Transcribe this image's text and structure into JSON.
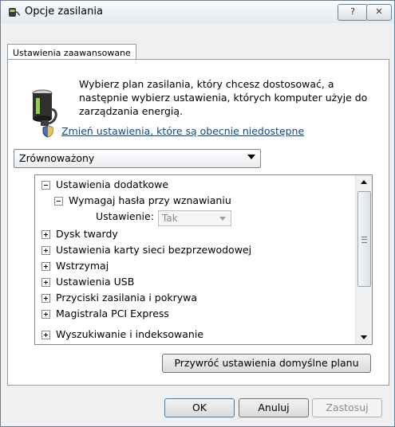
{
  "window": {
    "title": "Opcje zasilania",
    "help_label": "?",
    "close_label": "✕"
  },
  "tab": {
    "label": "Ustawienia zaawansowane"
  },
  "intro": {
    "text": "Wybierz plan zasilania, który chcesz dostosować, a następnie wybierz ustawienia, których komputer użyje do zarządzania energią.",
    "change_link": "Zmień ustawienia, które są obecnie niedostępne"
  },
  "plan_select": {
    "selected": "Zrównoważony"
  },
  "tree": {
    "items": [
      {
        "label": "Ustawienia dodatkowe",
        "expanded": true,
        "level": 0
      },
      {
        "label": "Wymagaj hasła przy wznawianiu",
        "expanded": true,
        "level": 1
      },
      {
        "label": "Ustawienie:",
        "value": "Tak",
        "level": 2
      },
      {
        "label": "Dysk twardy",
        "expanded": false,
        "level": 0
      },
      {
        "label": "Ustawienia karty sieci bezprzewodowej",
        "expanded": false,
        "level": 0
      },
      {
        "label": "Wstrzymaj",
        "expanded": false,
        "level": 0
      },
      {
        "label": "Ustawienia USB",
        "expanded": false,
        "level": 0
      },
      {
        "label": "Przyciski zasilania i pokrywa",
        "expanded": false,
        "level": 0
      },
      {
        "label": "Magistrala PCI Express",
        "expanded": false,
        "level": 0
      },
      {
        "label": "Wyszukiwanie i indeksowanie",
        "expanded": false,
        "level": 0
      }
    ]
  },
  "buttons": {
    "restore": "Przywróć ustawienia domyślne planu",
    "ok": "OK",
    "cancel": "Anuluj",
    "apply": "Zastosuj"
  },
  "icons": {
    "title": "power-options-icon",
    "battery": "battery-plug-icon",
    "shield": "shield-icon"
  }
}
